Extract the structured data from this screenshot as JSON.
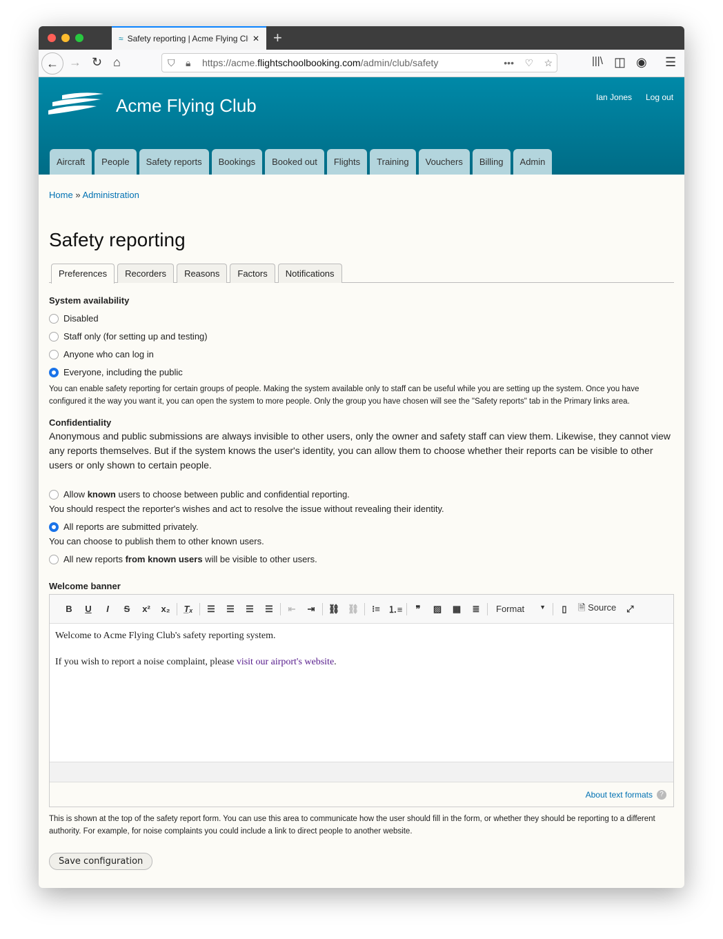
{
  "browser": {
    "tab_title": "Safety reporting | Acme Flying Club",
    "url_prefix": "https://acme.",
    "url_domain": "flightschoolbooking.com",
    "url_path": "/admin/club/safety"
  },
  "site": {
    "name": "Acme Flying Club",
    "user": "Ian Jones",
    "logout": "Log out",
    "brand_color": "#0089a8"
  },
  "nav": [
    "Aircraft",
    "People",
    "Safety reports",
    "Bookings",
    "Booked out",
    "Flights",
    "Training",
    "Vouchers",
    "Billing",
    "Admin"
  ],
  "breadcrumb": {
    "home": "Home",
    "sep": "»",
    "admin": "Administration"
  },
  "page_title": "Safety reporting",
  "local_tabs": [
    "Preferences",
    "Recorders",
    "Reasons",
    "Factors",
    "Notifications"
  ],
  "availability": {
    "label": "System availability",
    "options": [
      "Disabled",
      "Staff only (for setting up and testing)",
      "Anyone who can log in",
      "Everyone, including the public"
    ],
    "selected": 3,
    "description": "You can enable safety reporting for certain groups of people. Making the system available only to staff can be useful while you are setting up the system. Once you have configured it the way you want it, you can open the system to more people. Only the group you have chosen will see the \"Safety reports\" tab in the Primary links area."
  },
  "confidentiality": {
    "label": "Confidentiality",
    "description": "Anonymous and public submissions are always invisible to other users, only the owner and safety staff can view them. Likewise, they cannot view any reports themselves. But if the system knows the user's identity, you can allow them to choose whether their reports can be visible to other users or only shown to certain people.",
    "opt1_a": "Allow ",
    "opt1_b": "known",
    "opt1_c": " users to choose between public and confidential reporting.",
    "opt1_help": "You should respect the reporter's wishes and act to resolve the issue without revealing their identity.",
    "opt2": "All reports are submitted privately.",
    "opt2_help": "You can choose to publish them to other known users.",
    "opt3_a": "All new reports ",
    "opt3_b": "from known users",
    "opt3_c": " will be visible to other users.",
    "selected": 1
  },
  "banner": {
    "label": "Welcome banner",
    "format": "Format",
    "source": "Source",
    "line1": "Welcome to Acme Flying Club's safety reporting system.",
    "line2": "If you wish to report a noise complaint, please ",
    "link": "visit our airport's website",
    "line2_end": ".",
    "about": "About text formats",
    "help": "This is shown at the top of the safety report form. You can use this area to communicate how the user should fill in the form, or whether they should be reporting to a different authority. For example, for noise complaints you could include a link to direct people to another website."
  },
  "save": "Save configuration"
}
